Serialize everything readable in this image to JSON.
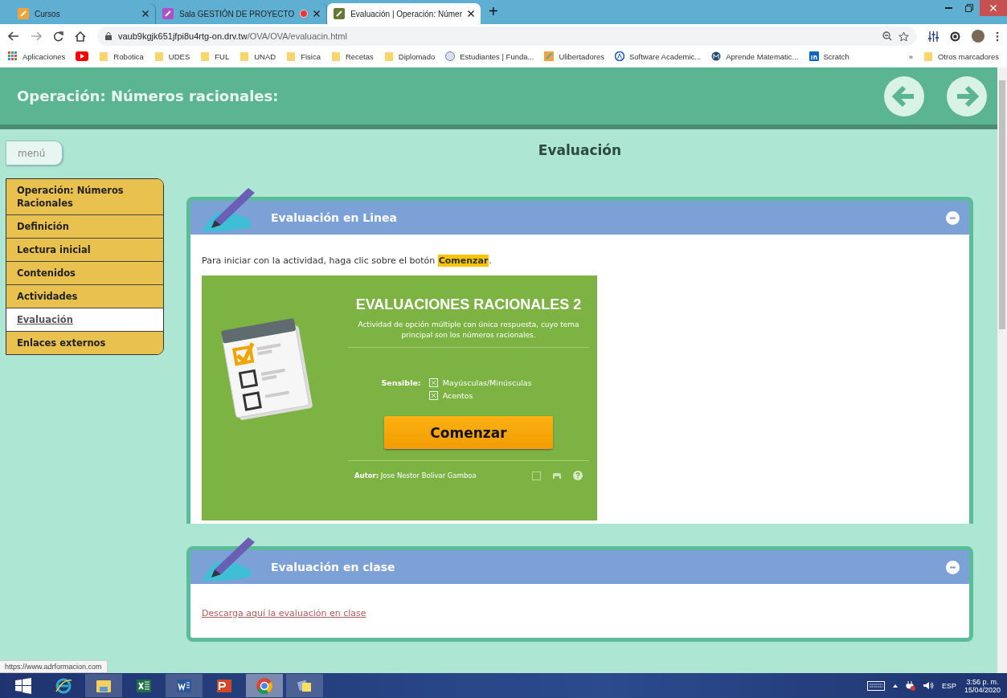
{
  "browser": {
    "tabs": [
      {
        "title": "Cursos",
        "kind": "pencil",
        "selected": false,
        "recording": false
      },
      {
        "title": "Sala GESTIÓN DE PROYECTO",
        "kind": "video",
        "selected": false,
        "recording": true
      },
      {
        "title": "Evaluación | Operación: Númer",
        "kind": "puzzle",
        "selected": true,
        "recording": false
      }
    ],
    "new_tab": "+",
    "url_host": "vaub9kgjk651jfpi8u4rtg-on.drv.tw",
    "url_path": "/OVA/OVA/evaluacin.html",
    "bookmarks": [
      {
        "label": "Aplicaciones",
        "kind": "apps"
      },
      {
        "kind": "video"
      },
      {
        "label": "Robotica",
        "kind": "folder"
      },
      {
        "label": "UDES",
        "kind": "folder"
      },
      {
        "label": "FUL",
        "kind": "folder"
      },
      {
        "label": "UNAD",
        "kind": "folder"
      },
      {
        "label": "Fisica",
        "kind": "folder"
      },
      {
        "label": "Recetas",
        "kind": "folder"
      },
      {
        "label": "Diplomado",
        "kind": "folder"
      },
      {
        "label": "Estudiantes | Funda...",
        "kind": "seal"
      },
      {
        "label": "Ulibertadores",
        "kind": "pencil"
      },
      {
        "label": "Software Academic...",
        "kind": "letter-a"
      },
      {
        "label": "Aprende Matematic...",
        "kind": "letter-m"
      },
      {
        "label": "Scratch",
        "kind": "in"
      }
    ],
    "bookmarks_more": "»",
    "other_bookmarks": "Otros marcadores"
  },
  "page": {
    "title": "Operación: Números racionales:",
    "menu_button": "menú",
    "nav": [
      {
        "label": "Operación: Números Racionales",
        "selected": false
      },
      {
        "label": "Definición",
        "selected": false
      },
      {
        "label": "Lectura inicial",
        "selected": false
      },
      {
        "label": "Contenidos",
        "selected": false
      },
      {
        "label": "Actividades",
        "selected": false
      },
      {
        "label": "Evaluación",
        "selected": true
      },
      {
        "label": "Enlaces externos",
        "selected": false
      }
    ],
    "heading": "Evaluación",
    "panels": [
      {
        "kind": "activity",
        "title": "Evaluación en Linea",
        "expanded": true,
        "intro": {
          "before": "Para iniciar con la actividad, haga clic sobre el botón ",
          "highlight": "Comenzar",
          "after": "."
        },
        "quiz": {
          "title": "EVALUACIONES RACIONALES 2",
          "description": "Actividad de opción múltiple con única respuesta, cuyo tema principal son los números racionales.",
          "sensitive_label": "Sensible:",
          "options": [
            {
              "label": "Mayúsculas/Minúsculas",
              "checked": true
            },
            {
              "label": "Acentos",
              "checked": true
            }
          ],
          "start": "Comenzar",
          "author_label": "Autor:",
          "author": "Jose Nestor Bolivar Gamboa"
        }
      },
      {
        "kind": "link",
        "title": "Evaluación en clase",
        "expanded": true,
        "link": "Descarga aquí la evaluación en clase"
      }
    ]
  },
  "status_link": "https://www.adrformacion.com",
  "taskbar": {
    "apps": [
      {
        "kind": "start",
        "running": false,
        "selected": false
      },
      {
        "kind": "ie",
        "running": false,
        "selected": false
      },
      {
        "kind": "explorer",
        "running": true,
        "selected": false
      },
      {
        "kind": "excel",
        "running": false,
        "selected": false
      },
      {
        "kind": "word",
        "running": true,
        "selected": false
      },
      {
        "kind": "powerpoint",
        "running": false,
        "selected": false
      },
      {
        "kind": "chrome",
        "running": true,
        "selected": true
      },
      {
        "kind": "notes",
        "running": true,
        "selected": false
      }
    ],
    "language": "ESP",
    "time": "3:56 p. m.",
    "date": "15/04/2020"
  }
}
